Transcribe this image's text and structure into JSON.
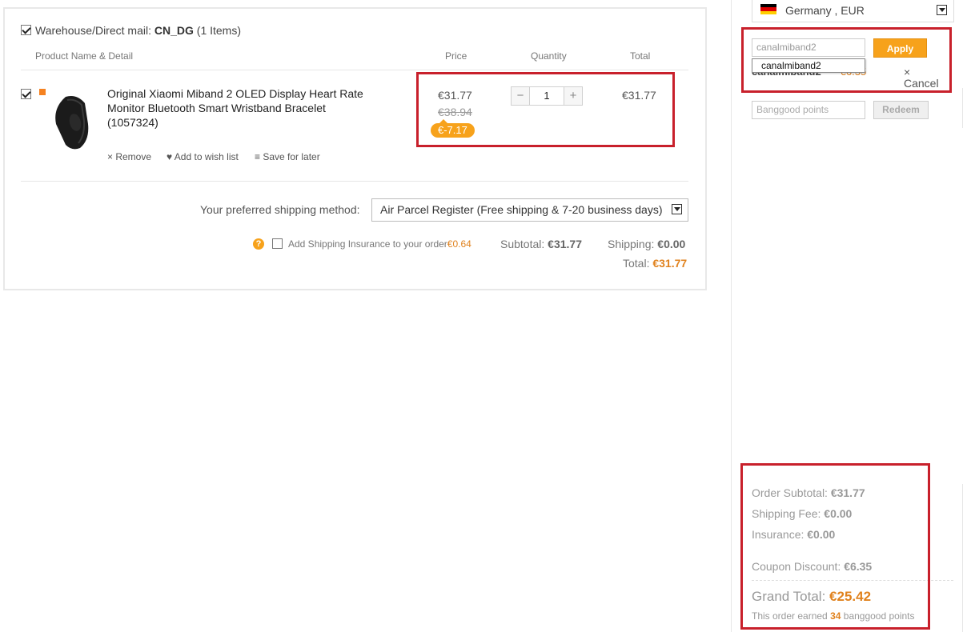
{
  "cart": {
    "warehouse_label": "Warehouse/Direct mail:",
    "warehouse_code": "CN_DG",
    "warehouse_count": "(1 Items)",
    "columns": {
      "product": "Product Name & Detail",
      "price": "Price",
      "quantity": "Quantity",
      "total": "Total"
    },
    "item": {
      "title": "Original Xiaomi Miband 2 OLED Display Heart Rate Monitor Bluetooth Smart Wristband Bracelet (1057324)",
      "price_now": "€31.77",
      "price_old": "€38.94",
      "discount": "€-7.17",
      "quantity": "1",
      "qty_minus": "−",
      "qty_plus": "+",
      "total": "€31.77",
      "remove": "× Remove",
      "wishlist": "♥ Add to wish list",
      "save_later": "≡ Save for later"
    },
    "shipping": {
      "label": "Your preferred shipping method:",
      "selected": "Air Parcel Register (Free shipping & 7-20 business days)"
    },
    "insurance": {
      "help": "?",
      "label": "Add Shipping Insurance to your order",
      "price": "€0.64"
    },
    "summary": {
      "subtotal_label": "Subtotal:",
      "subtotal": "€31.77",
      "shipping_label": "Shipping:",
      "shipping": "€0.00",
      "total_label": "Total:",
      "total": "€31.77"
    }
  },
  "sidebar": {
    "country": "Germany , EUR",
    "coupon": {
      "value": "canalmiband2",
      "apply_label": "Apply",
      "suggestion": "canalmiband2",
      "applied_code": "canalmiband2",
      "applied_amount": "-€6.35",
      "cancel_label": "× Cancel"
    },
    "points": {
      "placeholder": "Banggood points",
      "redeem_label": "Redeem"
    },
    "order": {
      "subtotal_label": "Order Subtotal:",
      "subtotal": "€31.77",
      "shipping_label": "Shipping Fee:",
      "shipping": "€0.00",
      "insurance_label": "Insurance:",
      "insurance": "€0.00",
      "coupon_label": "Coupon Discount:",
      "coupon": "€6.35",
      "grand_label": "Grand Total:",
      "grand": "€25.42",
      "earned_prefix": "This order earned",
      "earned_points": "34",
      "earned_suffix": "banggood points"
    }
  },
  "colors": {
    "accent": "#f7a21b",
    "price_orange": "#e0821e",
    "highlight_red": "#c8202b"
  }
}
